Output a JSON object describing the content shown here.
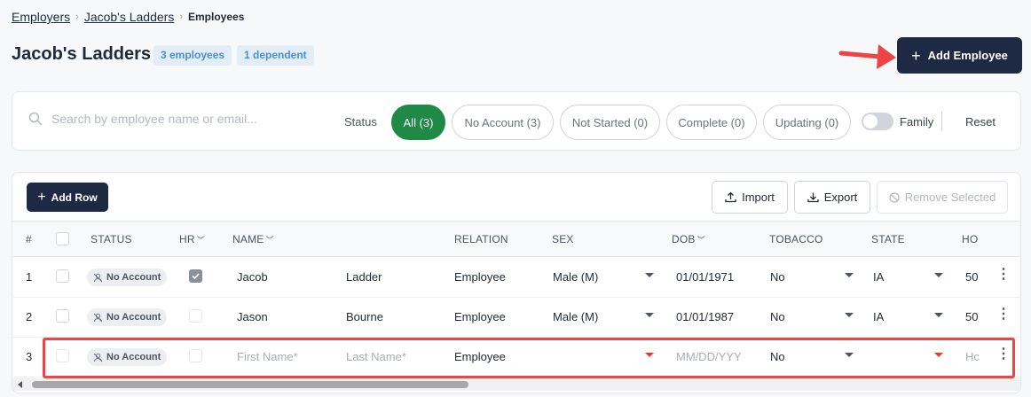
{
  "breadcrumb": {
    "employers": "Employers",
    "employer": "Jacob's Ladders",
    "current": "Employees",
    "separator": "›"
  },
  "header": {
    "title": "Jacob's Ladders",
    "employees_badge": "3 employees",
    "dependents_badge": "1 dependent",
    "add_employee_label": "Add Employee"
  },
  "filters": {
    "search_placeholder": "Search by employee name or email...",
    "status_label": "Status",
    "pills": [
      "All (3)",
      "No Account (3)",
      "Not Started (0)",
      "Complete (0)",
      "Updating (0)"
    ],
    "active_pill": "All (3)",
    "family_label": "Family",
    "family_toggle_on": false,
    "reset_label": "Reset"
  },
  "toolbar": {
    "add_row_label": "Add Row",
    "import_label": "Import",
    "export_label": "Export",
    "remove_label": "Remove Selected"
  },
  "columns": {
    "num": "#",
    "status": "STATUS",
    "hr": "HR",
    "name": "NAME",
    "relation": "RELATION",
    "sex": "SEX",
    "dob": "DOB",
    "tobacco": "TOBACCO",
    "state": "STATE",
    "next": "HO"
  },
  "rows": [
    {
      "num": "1",
      "status": "No Account",
      "hr_checked": true,
      "first": "Jacob",
      "last": "Ladder",
      "relation": "Employee",
      "sex": "Male (M)",
      "dob": "01/01/1971",
      "tobacco": "No",
      "state": "IA",
      "next": "50"
    },
    {
      "num": "2",
      "status": "No Account",
      "hr_checked": false,
      "first": "Jason",
      "last": "Bourne",
      "relation": "Employee",
      "sex": "Male (M)",
      "dob": "01/01/1987",
      "tobacco": "No",
      "state": "IA",
      "next": "50"
    },
    {
      "num": "3",
      "status": "No Account",
      "hr_checked": false,
      "first_placeholder": "First Name*",
      "last_placeholder": "Last Name*",
      "relation": "Employee",
      "sex": "",
      "dob_placeholder": "MM/DD/YYY",
      "tobacco": "No",
      "state": "",
      "next_placeholder": "Hc"
    }
  ],
  "colors": {
    "primary": "#1e2a44",
    "active_green": "#1e8a46",
    "badge_bg": "#e3edf7",
    "badge_text": "#4a8ed0",
    "highlight_red": "#ef4444"
  }
}
